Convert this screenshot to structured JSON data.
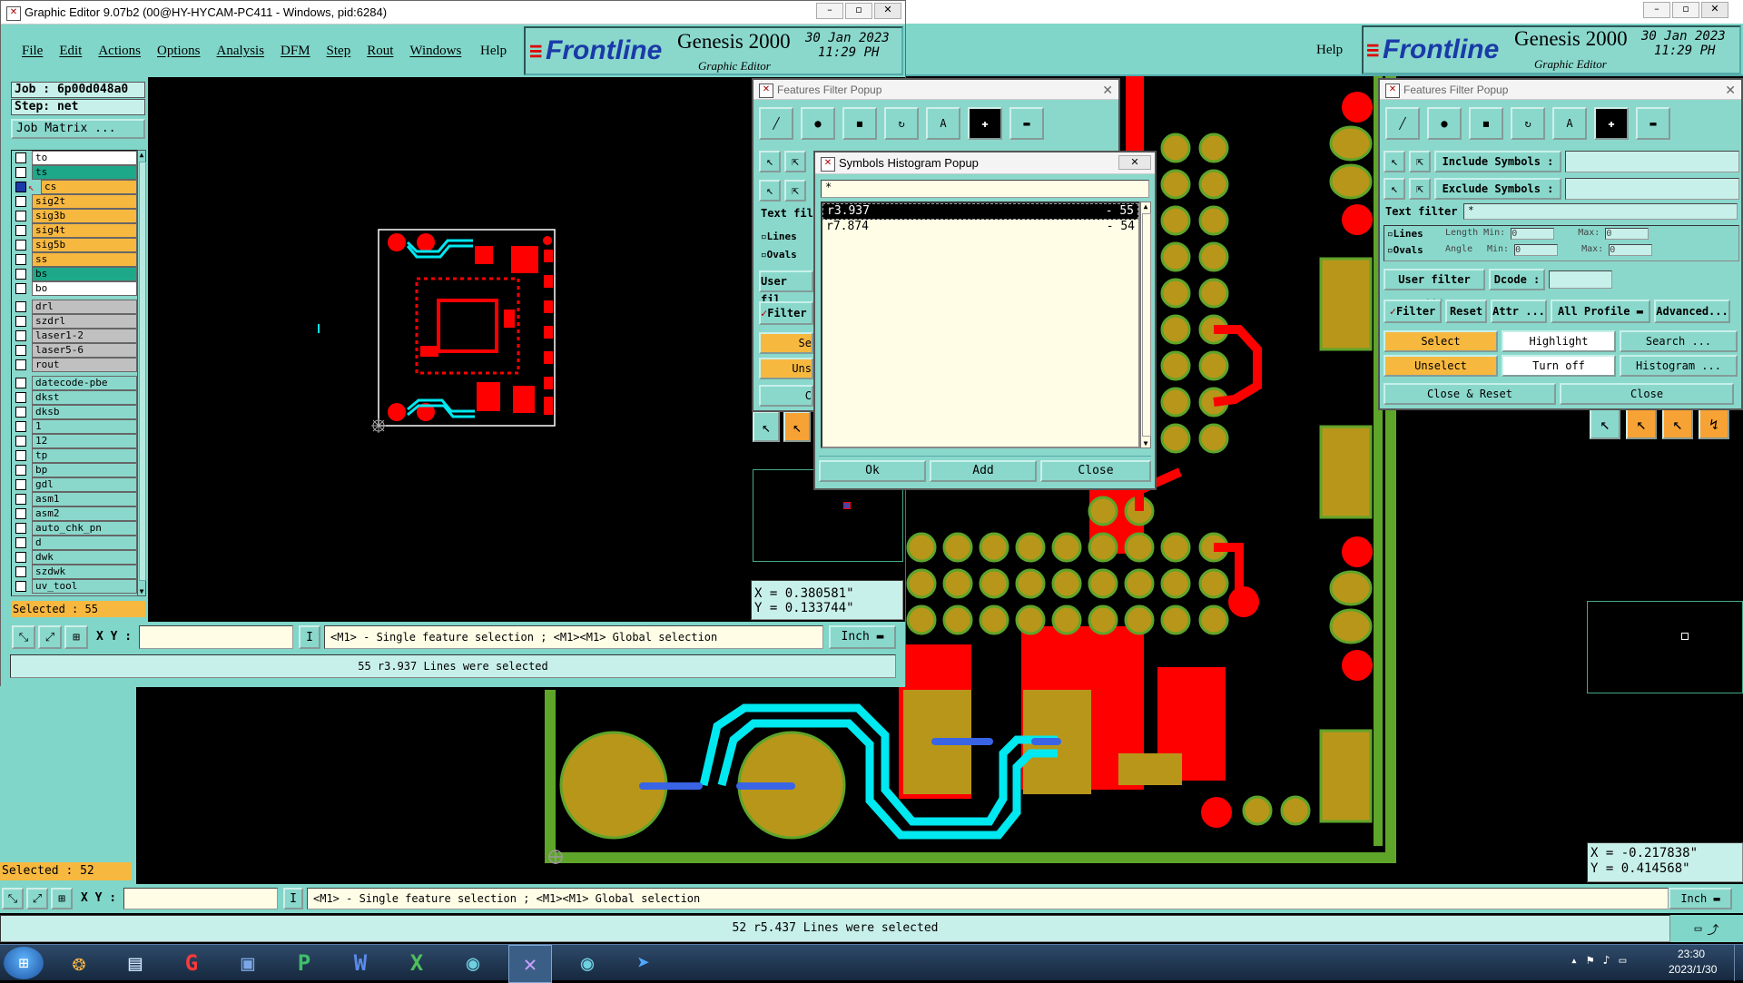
{
  "main_window": {
    "title": "Graphic Editor 9.07b2 (00@HY-HYCAM-PC411 - Windows, pid:6284)",
    "menu": [
      "File",
      "Edit",
      "Actions",
      "Options",
      "Analysis",
      "DFM",
      "Step",
      "Rout",
      "Windows"
    ],
    "help": "Help",
    "brand": "Frontline",
    "product": "Genesis 2000",
    "subtitle": "Graphic Editor",
    "date": "30 Jan 2023",
    "time": "11:29 PH",
    "job": "Job : 6p00d048a0",
    "step": "Step: net",
    "job_matrix": "Job Matrix ...",
    "layers_group1": [
      "to",
      "ts",
      "cs",
      "sig2t",
      "sig3b",
      "sig4t",
      "sig5b",
      "ss",
      "bs",
      "bo"
    ],
    "layers_group2": [
      "drl",
      "szdrl",
      "laser1-2",
      "laser5-6",
      "rout"
    ],
    "layers_group3": [
      "datecode-pbe",
      "dkst",
      "dksb",
      "1",
      "12",
      "tp",
      "bp",
      "gdl",
      "asm1",
      "asm2",
      "auto_chk_pn",
      "d",
      "dwk",
      "szdwk",
      "uv_tool"
    ],
    "selected": "Selected : 55",
    "xy_label": "X Y :",
    "xy_value": "",
    "hint": "<M1> - Single feature selection ; <M1><M1> Global selection",
    "units": "Inch",
    "status": "55 r3.937 Lines were selected"
  },
  "back_window": {
    "help": "Help",
    "brand": "Frontline",
    "product": "Genesis 2000",
    "subtitle": "Graphic Editor",
    "date": "30 Jan 2023",
    "time": "11:29 PH",
    "coord_x": "X = -0.217838\"",
    "coord_y": "Y = 0.414568\"",
    "selected": "Selected : 52",
    "xy_label": "X Y :",
    "hint": "<M1> - Single feature selection ; <M1><M1> Global selection",
    "units": "Inch",
    "status": "52 r5.437 Lines were selected"
  },
  "mid_coords": {
    "x": "X = 0.380581\"",
    "y": "Y = 0.133744\""
  },
  "features_filter_left": {
    "title": "Features Filter Popup",
    "text_filter": "Text fil",
    "lines": "Lines",
    "ovals": "Ovals",
    "user_filter": "User fil",
    "filter": "Filter",
    "select_short": "Se",
    "unselect_short": "Uns",
    "close_short": "C"
  },
  "histogram": {
    "title": "Symbols Histogram Popup",
    "filter": "*",
    "rows": [
      {
        "symbol": "r3.937",
        "count": "- 55"
      },
      {
        "symbol": "r7.874",
        "count": "- 54"
      }
    ],
    "ok": "Ok",
    "add": "Add",
    "close": "Close"
  },
  "features_filter_right": {
    "title": "Features Filter Popup",
    "include_symbols": "Include Symbols :",
    "exclude_symbols": "Exclude Symbols :",
    "text_filter": "Text filter",
    "text_filter_value": "*",
    "lines": "Lines",
    "ovals": "Ovals",
    "length": "Length",
    "angle": "Angle",
    "min": "Min:",
    "max": "Max:",
    "min_val": "0",
    "max_val": "0",
    "user_filter": "User filter ...",
    "dcode": "Dcode :",
    "filter": "Filter",
    "reset": "Reset",
    "attr": "Attr ...",
    "all_profile": "All Profile",
    "advanced": "Advanced...",
    "select": "Select",
    "highlight": "Highlight",
    "search": "Search ...",
    "unselect": "Unselect",
    "turn_off": "Turn off",
    "histogram": "Histogram ...",
    "close_reset": "Close & Reset",
    "close": "Close"
  },
  "taskbar": {
    "time": "23:30",
    "date": "2023/1/30"
  },
  "colors": {
    "teal": "#8ad8cc",
    "pcb_red": "#ff0000",
    "pcb_gold": "#b8961a",
    "pcb_green": "#5fa52a",
    "trace_cyan": "#00e8f0",
    "selected_blue": "#3a64e6"
  }
}
